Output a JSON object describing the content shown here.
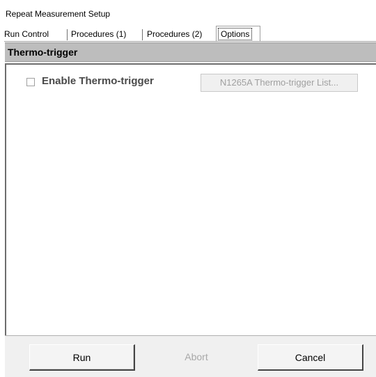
{
  "window": {
    "title": "Repeat Measurement Setup"
  },
  "tabs": [
    {
      "label": "Run Control",
      "active": false
    },
    {
      "label": "Procedures (1)",
      "active": false
    },
    {
      "label": "Procedures (2)",
      "active": false
    },
    {
      "label": "Options",
      "active": true
    }
  ],
  "section": {
    "header": "Thermo-trigger"
  },
  "options": {
    "enable_thermo_trigger": {
      "label": "Enable Thermo-trigger",
      "checked": false
    },
    "list_button": {
      "label": "N1265A Thermo-trigger List...",
      "enabled": false
    }
  },
  "footer": {
    "run_label": "Run",
    "abort_label": "Abort",
    "abort_enabled": false,
    "cancel_label": "Cancel"
  },
  "colors": {
    "header_bg": "#bdbdbd",
    "footer_bg": "#f0f0f0",
    "disabled_text": "#a0a0a0"
  }
}
